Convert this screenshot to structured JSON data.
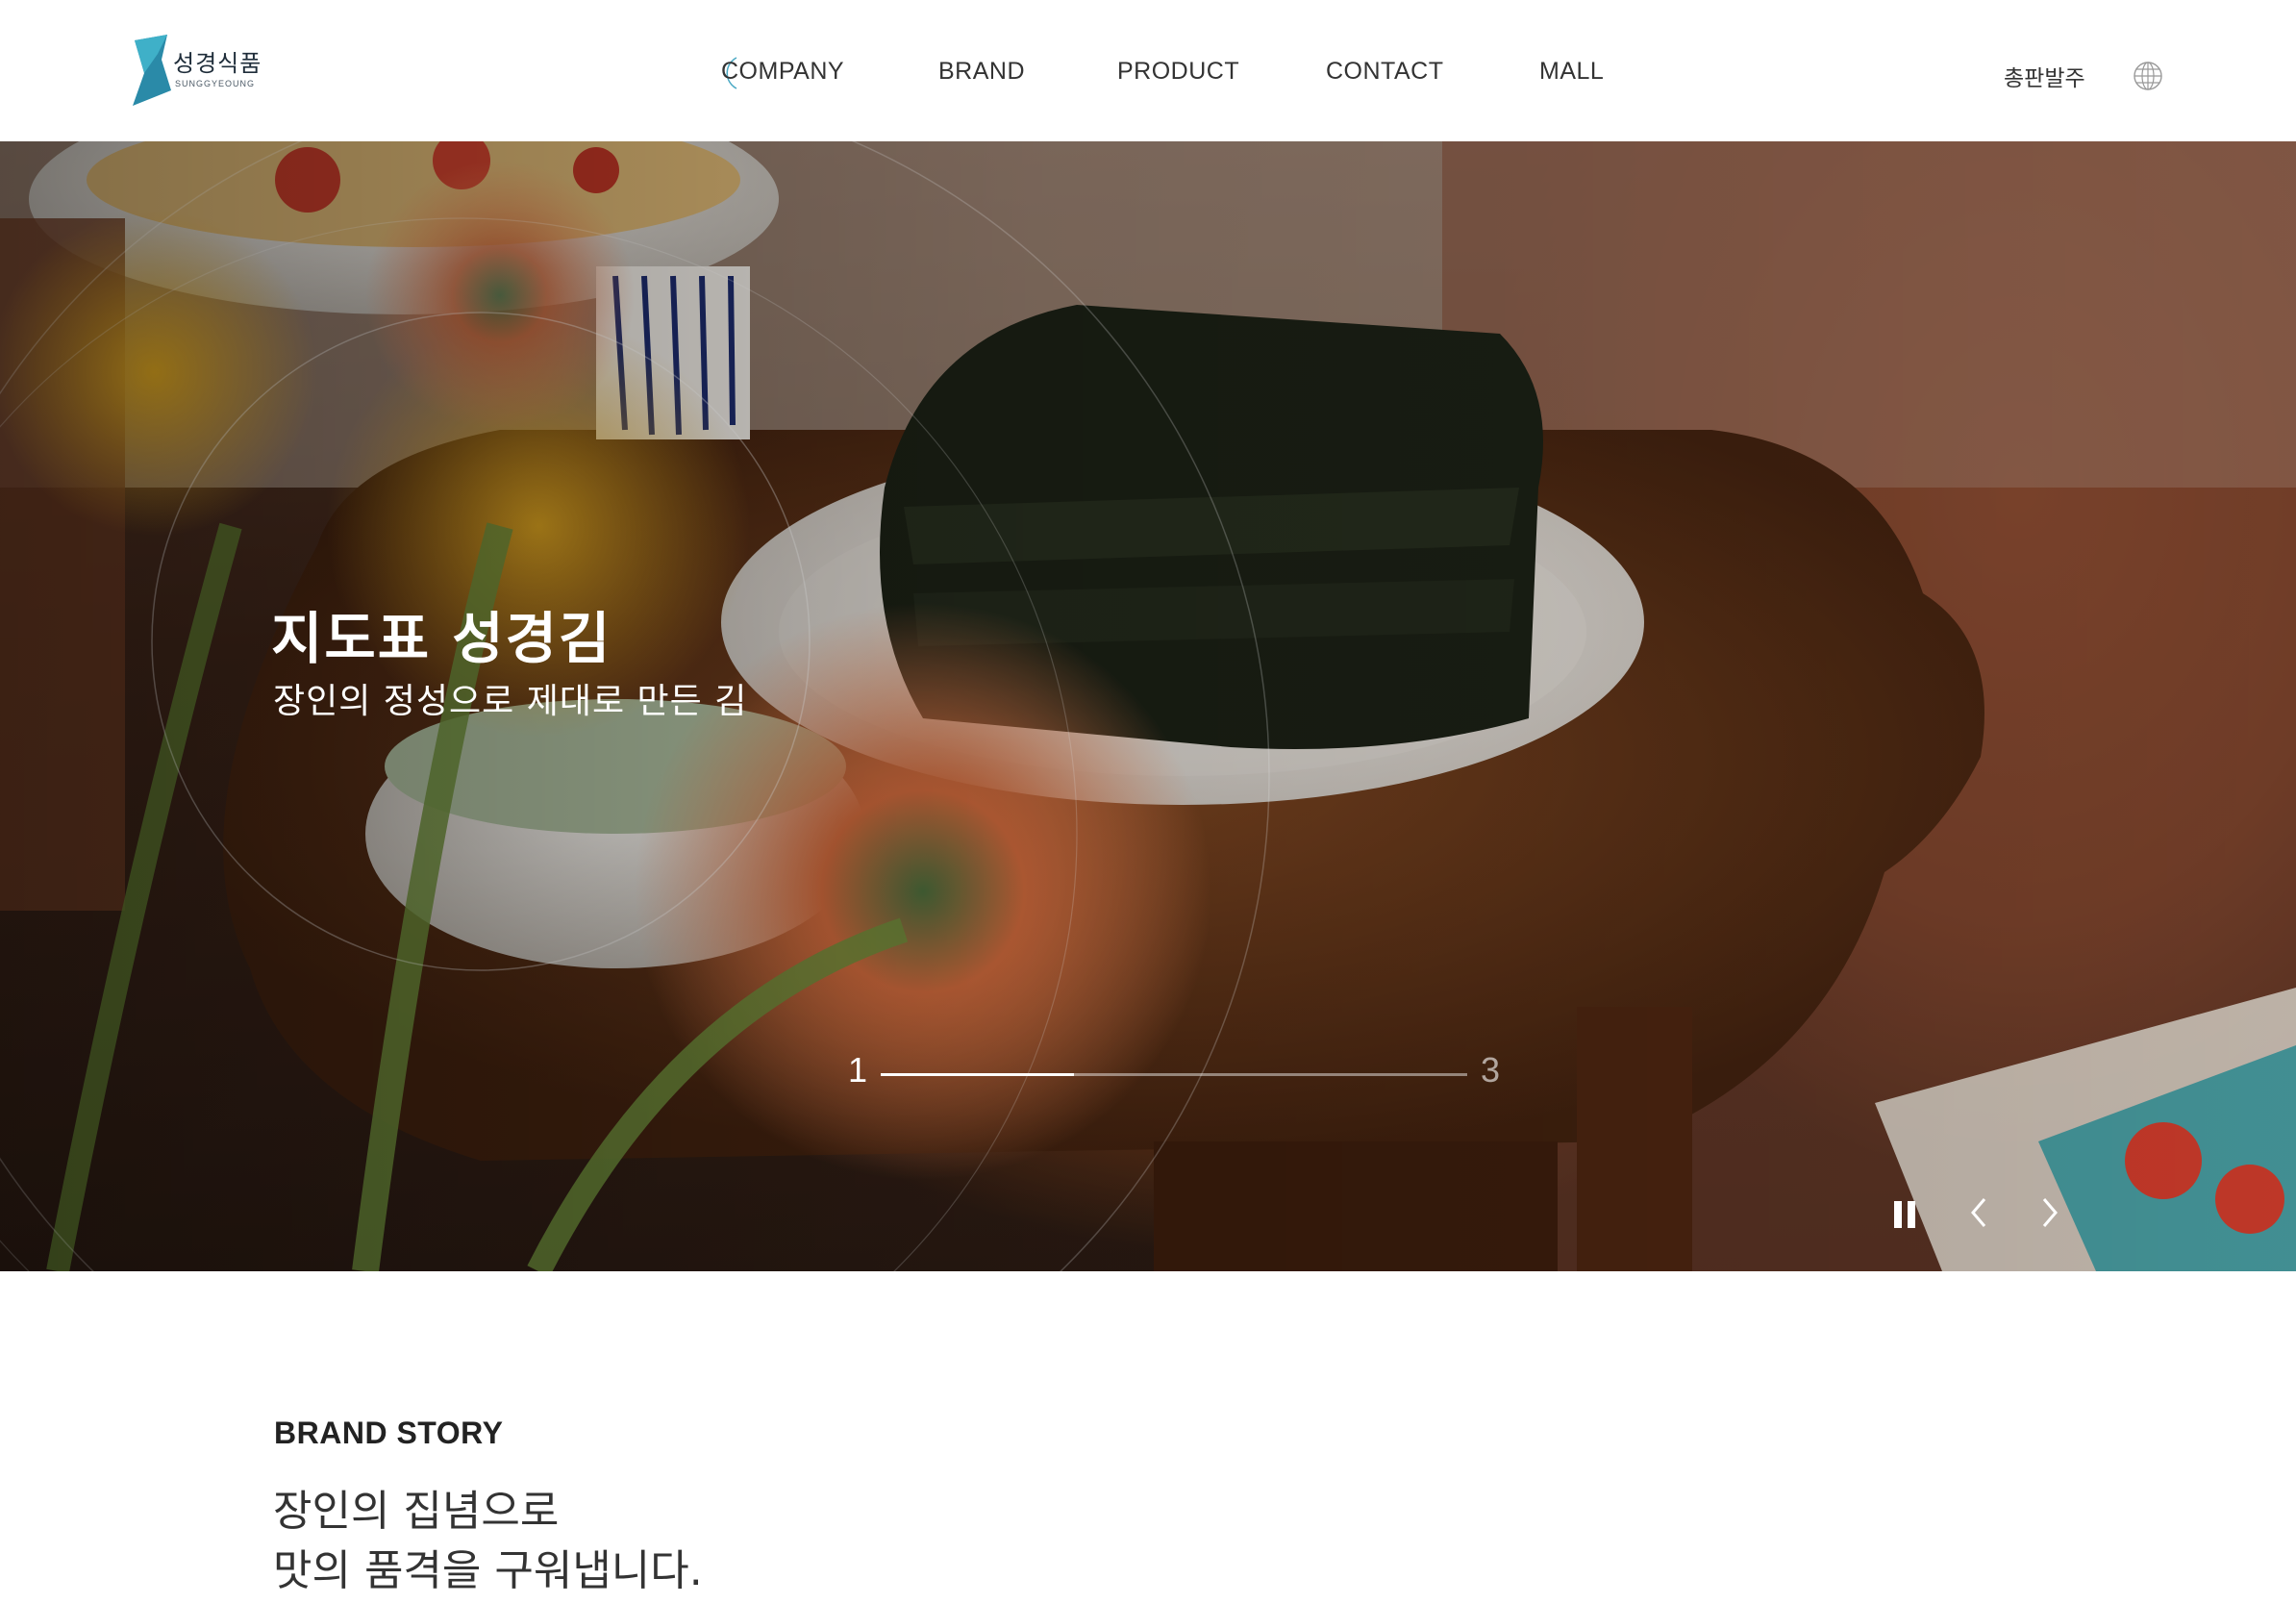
{
  "header": {
    "logo": {
      "name_ko": "성경식품",
      "name_en": "SUNGGYEOUNG",
      "colors": {
        "primary": "#1e7a96",
        "secondary": "#3aa3be"
      }
    },
    "nav": [
      {
        "label": "COMPANY"
      },
      {
        "label": "BRAND"
      },
      {
        "label": "PRODUCT"
      },
      {
        "label": "CONTACT"
      },
      {
        "label": "MALL"
      }
    ],
    "order_label": "총판발주",
    "language_icon": "globe-icon"
  },
  "hero": {
    "title": "지도표 성경김",
    "subtitle": "장인의 정성으로 제대로 만든 김",
    "slider": {
      "current": "1",
      "total": "3",
      "progress": 0.33
    },
    "controls": {
      "pause_icon": "pause-icon",
      "prev_icon": "chevron-left-icon",
      "next_icon": "chevron-right-icon"
    }
  },
  "brand_story": {
    "label": "BRAND STORY",
    "line1": "장인의 집념으로",
    "line2": "맛의 품격을 구워냅니다."
  }
}
